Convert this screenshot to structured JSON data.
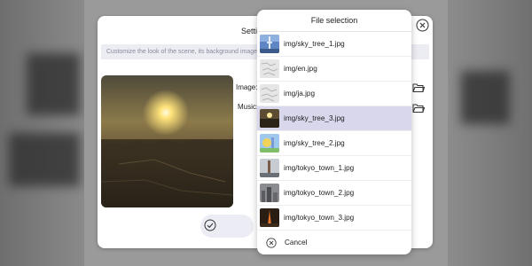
{
  "settings_dialog": {
    "title": "Setti",
    "description": "Customize the look of the scene, its background image a",
    "image_label": "Image:",
    "music_label": "Music:",
    "confirm_partial": "A"
  },
  "file_selection": {
    "title": "File selection",
    "files": [
      {
        "label": "img/sky_tree_1.jpg",
        "thumb": "sky-tree-thumbnail"
      },
      {
        "label": "img/en.jpg",
        "thumb": "map-thumbnail"
      },
      {
        "label": "img/ja.jpg",
        "thumb": "map-thumbnail"
      },
      {
        "label": "img/sky_tree_3.jpg",
        "thumb": "sunset-thumbnail"
      },
      {
        "label": "img/sky_tree_2.jpg",
        "thumb": "cartoon-thumbnail"
      },
      {
        "label": "img/tokyo_town_1.jpg",
        "thumb": "tower-thumbnail"
      },
      {
        "label": "img/tokyo_town_2.jpg",
        "thumb": "city-thumbnail"
      },
      {
        "label": "img/tokyo_town_3.jpg",
        "thumb": "night-tower-thumbnail"
      }
    ],
    "selected_index": 3,
    "cancel_label": "Cancel"
  },
  "colors": {
    "selected_row": "#d9d7ec",
    "description_bg": "#ececf3",
    "overlay": "#9a9a9a"
  }
}
